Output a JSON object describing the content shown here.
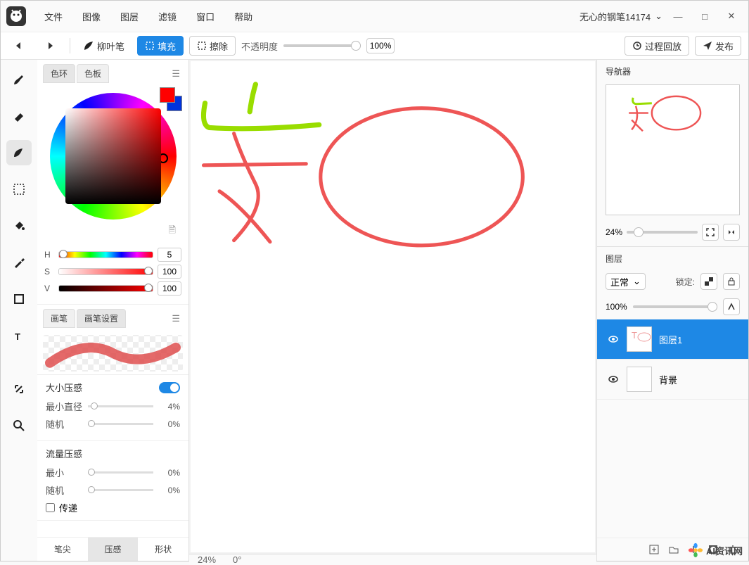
{
  "menu": {
    "items": [
      "文件",
      "图像",
      "图层",
      "滤镜",
      "窗口",
      "帮助"
    ]
  },
  "user": {
    "name": "无心的钢笔14174"
  },
  "toolbar": {
    "brush_label": "柳叶笔",
    "fill_label": "填充",
    "erase_label": "擦除",
    "opacity_label": "不透明度",
    "opacity_value": "100%",
    "playback_label": "过程回放",
    "publish_label": "发布"
  },
  "color_panel": {
    "tabs": [
      "色环",
      "色板"
    ],
    "active_tab": 0,
    "hsv": {
      "H": "5",
      "S": "100",
      "V": "100"
    },
    "fg": "#ff0000",
    "bg": "#0033dd"
  },
  "brush_panel": {
    "tabs": [
      "画笔",
      "画笔设置"
    ],
    "active_tab": 1,
    "size_section": {
      "title": "大小压感",
      "on": true,
      "rows": [
        {
          "label": "最小直径",
          "value": "4%"
        },
        {
          "label": "随机",
          "value": "0%"
        }
      ]
    },
    "flow_section": {
      "title": "流量压感",
      "rows": [
        {
          "label": "最小",
          "value": "0%"
        },
        {
          "label": "随机",
          "value": "0%"
        }
      ],
      "pass_label": "传递"
    },
    "bottom_tabs": [
      "笔尖",
      "压感",
      "形状"
    ],
    "active_btab": 1
  },
  "canvas": {
    "zoom": "24%",
    "angle": "0°"
  },
  "navigator": {
    "title": "导航器",
    "zoom": "24%"
  },
  "layers": {
    "title": "图层",
    "blend": "正常",
    "lock_label": "锁定:",
    "opacity": "100%",
    "items": [
      {
        "name": "图层1",
        "active": true
      },
      {
        "name": "背景",
        "active": false
      }
    ]
  },
  "watermark": "AI资讯网"
}
